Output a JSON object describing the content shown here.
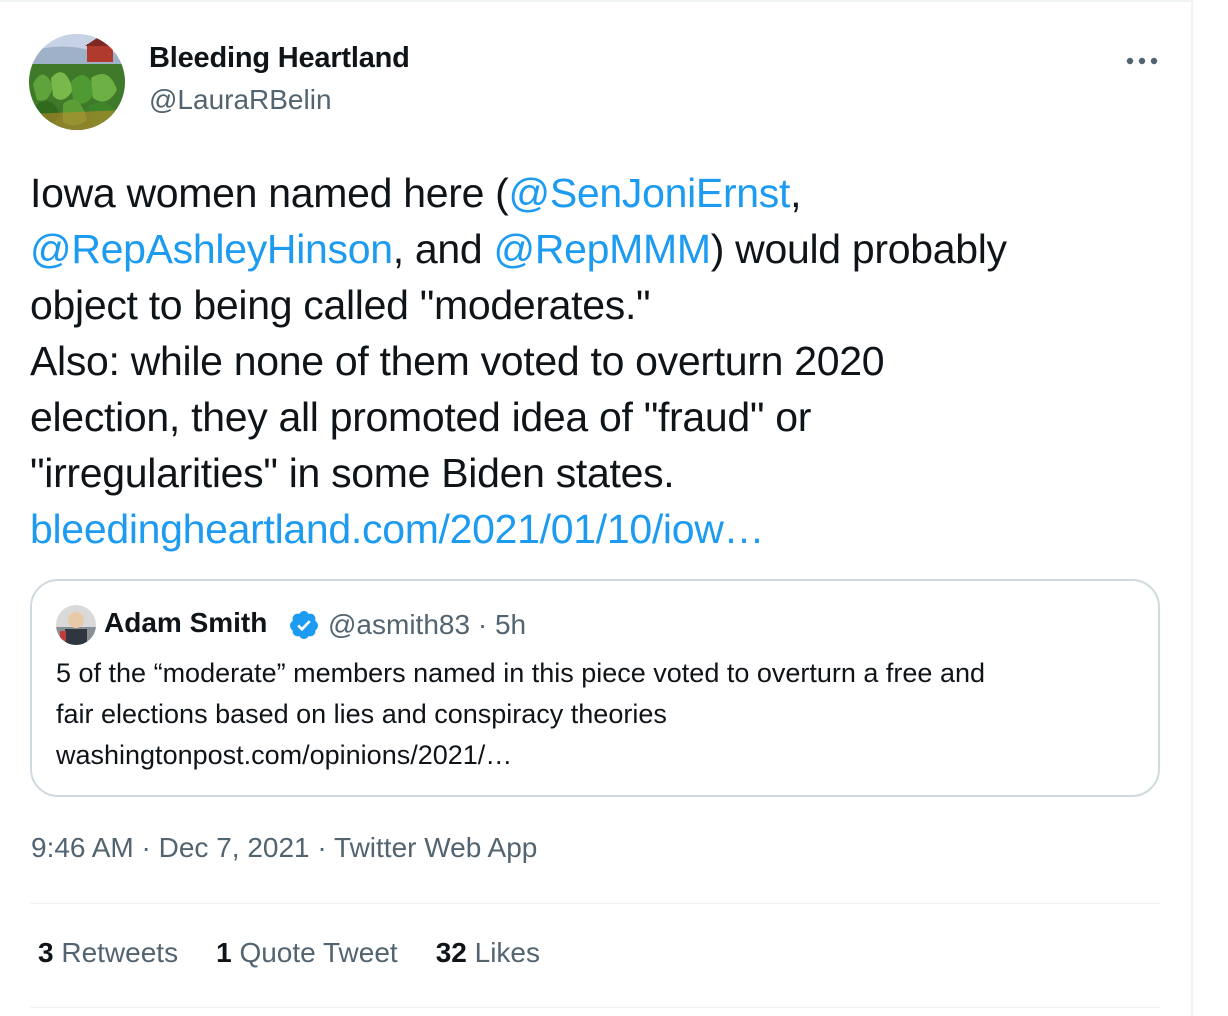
{
  "tweet": {
    "author": {
      "name": "Bleeding Heartland",
      "handle": "@LauraRBelin"
    },
    "text_lines": [
      [
        "Iowa women named here (",
        "@SenJoniErnst",
        ","
      ],
      [
        "@RepAshleyHinson",
        ", and ",
        "@RepMMM",
        ") would probably"
      ],
      [
        "object to being called \"moderates.\""
      ],
      [
        "Also: while none of them voted to overturn 2020"
      ],
      [
        "election, they all promoted idea of \"fraud\" or"
      ],
      [
        "\"irregularities\" in some Biden states."
      ],
      [
        "bleedingheartland.com/2021/01/10/iow…"
      ]
    ],
    "text": {
      "l1_pre": "Iowa women named here (",
      "m1": "@SenJoniErnst",
      "l1_post": ",",
      "m2": "@RepAshleyHinson",
      "l2_mid": ", and ",
      "m3": "@RepMMM",
      "l2_post": ") would probably",
      "l3": "object to being called \"moderates.\"",
      "l4": "Also: while none of them voted to overturn 2020",
      "l5": "election, they all promoted idea of \"fraud\" or",
      "l6": "\"irregularities\" in some Biden states.",
      "link": "bleedingheartland.com/2021/01/10/iow…"
    },
    "quoted": {
      "name": "Adam Smith",
      "verified": true,
      "handle": "@asmith83",
      "separator": "·",
      "time": "5h",
      "l1": "5 of the “moderate” members named in this piece voted to overturn a free and",
      "l2": "fair elections based on lies and conspiracy theories",
      "l3": "washingtonpost.com/opinions/2021/…"
    },
    "meta": {
      "time": "9:46 AM",
      "sep": " · ",
      "date": "Dec 7, 2021",
      "app": "Twitter Web App"
    },
    "stats": {
      "retweets_count": "3",
      "retweets_label": "Retweets",
      "quotes_count": "1",
      "quotes_label": "Quote Tweet",
      "likes_count": "32",
      "likes_label": "Likes"
    }
  },
  "colors": {
    "link": "#1d9bf0",
    "text": "#0f1419",
    "muted": "#536471",
    "border": "#cfd9de",
    "verified": "#1d9bf0"
  },
  "icons": {
    "more": "more-horizontal-icon",
    "verified": "verified-badge-icon"
  }
}
